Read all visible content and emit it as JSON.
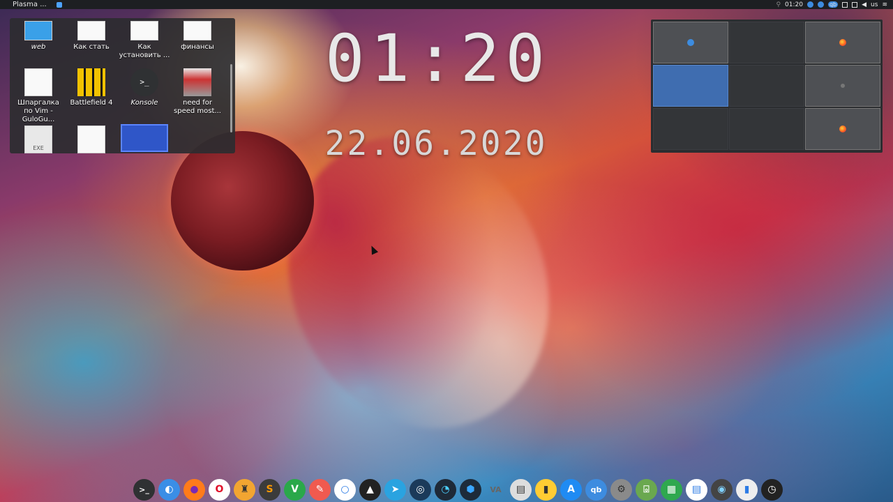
{
  "topbar": {
    "app_title": "Plasma ...",
    "tray_time": "01:20",
    "tray_qb": "qb",
    "tray_lang": "us"
  },
  "folder": {
    "items": [
      {
        "label": "web",
        "icon": "web-folder-icon",
        "italic": true
      },
      {
        "label": "Как стать",
        "icon": "document-icon"
      },
      {
        "label": "Как установить ...",
        "icon": "document-icon"
      },
      {
        "label": "финансы",
        "icon": "document-icon"
      },
      {
        "label": "Шпаргалка по Vim - GuloGu...",
        "icon": "document-icon"
      },
      {
        "label": "Battlefield 4",
        "icon": "battlefield-icon"
      },
      {
        "label": "Konsole",
        "icon": "terminal-icon",
        "italic": true
      },
      {
        "label": "need for speed most...",
        "icon": "nfs-icon"
      },
      {
        "label": "",
        "icon": "exe-icon",
        "glyph": "EXE"
      },
      {
        "label": "",
        "icon": "blank-document-icon"
      },
      {
        "label": "",
        "icon": "selected-image-icon"
      }
    ]
  },
  "clock": {
    "time": "01:20",
    "date": "22.06.2020"
  },
  "pager": {
    "desktops": [
      {
        "state": "window",
        "app": "blue-app"
      },
      {
        "state": "empty"
      },
      {
        "state": "window",
        "app": "firefox"
      },
      {
        "state": "active"
      },
      {
        "state": "empty"
      },
      {
        "state": "window",
        "app": "gray-app"
      },
      {
        "state": "empty"
      },
      {
        "state": "empty"
      },
      {
        "state": "window",
        "app": "firefox"
      }
    ]
  },
  "dock": {
    "icons": [
      {
        "name": "apple-icon",
        "glyph": "",
        "bg": "transparent",
        "fg": "#dddddd"
      },
      {
        "name": "terminal-icon",
        "glyph": ">_",
        "bg": "#2f3133",
        "fg": "#ffffff"
      },
      {
        "name": "finder-icon",
        "glyph": "◐",
        "bg": "#3a8ee6",
        "fg": "#ffffff"
      },
      {
        "name": "firefox-icon",
        "glyph": "●",
        "bg": "#ff7b1a",
        "fg": "#7a2ab4"
      },
      {
        "name": "opera-icon",
        "glyph": "O",
        "bg": "#ffffff",
        "fg": "#e0112b"
      },
      {
        "name": "joystick-icon",
        "glyph": "♜",
        "bg": "#f2a531",
        "fg": "#333333"
      },
      {
        "name": "sublime-icon",
        "glyph": "S",
        "bg": "#3b3b3b",
        "fg": "#ff9800"
      },
      {
        "name": "vim-icon",
        "glyph": "V",
        "bg": "#2aa84a",
        "fg": "#ffffff"
      },
      {
        "name": "pencil-icon",
        "glyph": "✎",
        "bg": "#f05a4f",
        "fg": "#ffffff"
      },
      {
        "name": "circle-app-icon",
        "glyph": "○",
        "bg": "#ffffff",
        "fg": "#2c7be5"
      },
      {
        "name": "inkscape-icon",
        "glyph": "▲",
        "bg": "#222222",
        "fg": "#ffffff"
      },
      {
        "name": "telegram-icon",
        "glyph": "➤",
        "bg": "#2aa3e0",
        "fg": "#ffffff"
      },
      {
        "name": "steam-icon",
        "glyph": "◎",
        "bg": "#1b3a5a",
        "fg": "#ffffff"
      },
      {
        "name": "speedometer-icon",
        "glyph": "◔",
        "bg": "#1e2a38",
        "fg": "#4cd0ff"
      },
      {
        "name": "hexagon-app-icon",
        "glyph": "⬢",
        "bg": "#1d2b3a",
        "fg": "#3aa6ff"
      },
      {
        "name": "vlc-text-icon",
        "glyph": "VA",
        "bg": "transparent",
        "fg": "#666666"
      },
      {
        "name": "archive-icon",
        "glyph": "▤",
        "bg": "#dddddd",
        "fg": "#333333"
      },
      {
        "name": "notes-icon",
        "glyph": "▮",
        "bg": "#ffcc33",
        "fg": "#333333"
      },
      {
        "name": "appstore-icon",
        "glyph": "A",
        "bg": "#1f8bf3",
        "fg": "#ffffff"
      },
      {
        "name": "qbittorrent-icon",
        "glyph": "qb",
        "bg": "#3d8ce0",
        "fg": "#ffffff"
      },
      {
        "name": "settings-gear-icon",
        "glyph": "⚙",
        "bg": "#8a8a8a",
        "fg": "#333333"
      },
      {
        "name": "basket-icon",
        "glyph": "⌺",
        "bg": "#6aa84f",
        "fg": "#ffffff"
      },
      {
        "name": "spreadsheet-icon",
        "glyph": "▦",
        "bg": "#2fa84f",
        "fg": "#ffffff"
      },
      {
        "name": "document-viewer-icon",
        "glyph": "▤",
        "bg": "#ffffff",
        "fg": "#2c7be5"
      },
      {
        "name": "disc-icon",
        "glyph": "◉",
        "bg": "#444444",
        "fg": "#7fd0ff"
      },
      {
        "name": "text-editor-icon",
        "glyph": "▮",
        "bg": "#eeeeee",
        "fg": "#2c7be5"
      },
      {
        "name": "clock-icon",
        "glyph": "◷",
        "bg": "#222222",
        "fg": "#ffffff"
      }
    ]
  }
}
